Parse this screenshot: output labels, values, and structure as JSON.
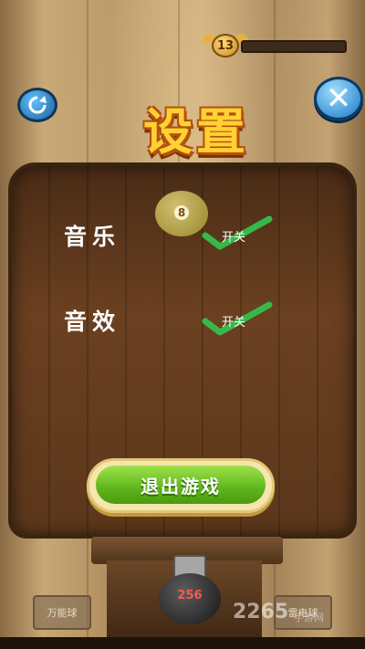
{
  "header": {
    "level": "13",
    "progress": 0.0
  },
  "settings": {
    "title": "设置",
    "music_label": "音乐",
    "sound_label": "音效",
    "music_toggle_text": "开关",
    "sound_toggle_text": "开关",
    "music_enabled": true,
    "sound_enabled": true,
    "exit_button_label": "退出游戏"
  },
  "game": {
    "ball_number": "8",
    "ball_count": "256"
  },
  "skills": {
    "left_label": "万能球",
    "right_label": "雷电球"
  },
  "watermark": {
    "main": "2265",
    "sub": "手游网"
  },
  "colors": {
    "title_yellow": "#ffd233",
    "check_green": "#37b84a",
    "exit_green": "#5fb51c",
    "close_blue": "#1a77c5"
  },
  "icons": {
    "refresh": "refresh-icon",
    "close": "close-icon",
    "check": "check-icon"
  }
}
